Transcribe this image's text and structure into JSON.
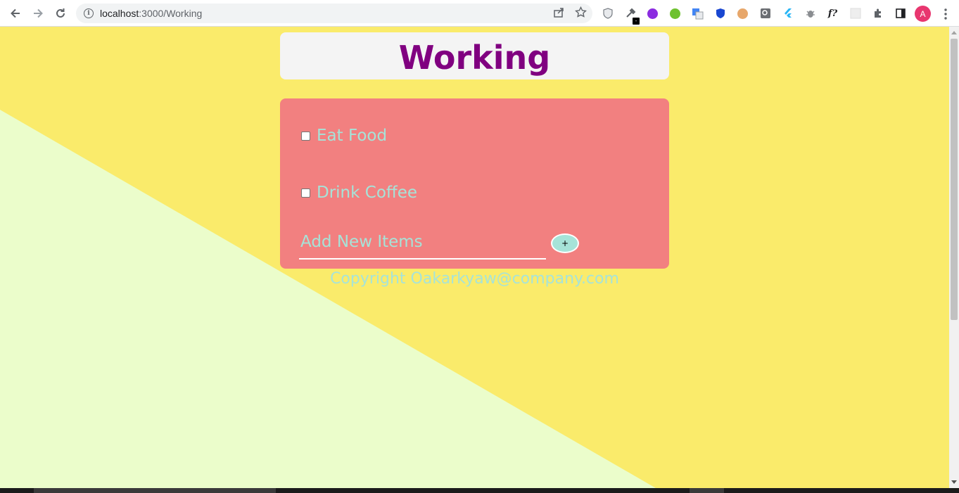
{
  "browser": {
    "url_host": "localhost",
    "url_path": ":3000/Working",
    "profile_initial": "A",
    "extensions": [
      "shield-icon",
      "eyedropper-icon",
      "purple-circle-icon",
      "green-circle-icon",
      "translate-icon",
      "blue-shield-icon",
      "face-icon",
      "search-ext-icon",
      "flutter-icon",
      "bug-icon",
      "font-icon",
      "grid-icon",
      "puzzle-icon",
      "sidepanel-icon"
    ],
    "font_ext_label": "f?"
  },
  "page": {
    "title": "Working",
    "items": [
      {
        "label": "Eat Food",
        "checked": false
      },
      {
        "label": "Drink Coffee",
        "checked": false
      }
    ],
    "new_item_placeholder": "Add New Items",
    "add_button_label": "+",
    "footer": "Copyright Oakarkyaw@company.com"
  },
  "colors": {
    "background_yellow": "#faeb6b",
    "background_green": "#ebfdcb",
    "title": "#800080",
    "card": "#f28080",
    "accent_text": "#a6e3d8"
  }
}
